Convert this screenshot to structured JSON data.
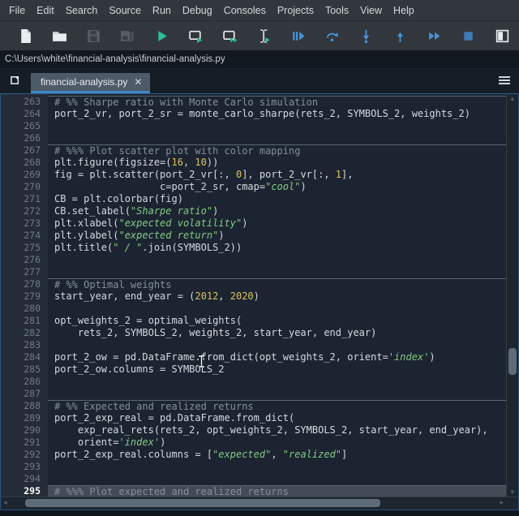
{
  "menu": {
    "items": [
      "File",
      "Edit",
      "Search",
      "Source",
      "Run",
      "Debug",
      "Consoles",
      "Projects",
      "Tools",
      "View",
      "Help"
    ]
  },
  "toolbar": {
    "buttons": [
      {
        "name": "new-file",
        "icon": "new-file-icon",
        "enabled": true
      },
      {
        "name": "open-file",
        "icon": "open-folder-icon",
        "enabled": true
      },
      {
        "name": "save-file",
        "icon": "save-icon",
        "enabled": false
      },
      {
        "name": "save-all",
        "icon": "save-all-icon",
        "enabled": false
      },
      {
        "name": "run-file",
        "icon": "run-icon",
        "enabled": true
      },
      {
        "name": "run-cell",
        "icon": "run-cell-icon",
        "enabled": true
      },
      {
        "name": "run-cell-advance",
        "icon": "run-cell-advance-icon",
        "enabled": true
      },
      {
        "name": "run-selection",
        "icon": "run-selection-icon",
        "enabled": true
      },
      {
        "name": "debug-file",
        "icon": "debug-icon",
        "enabled": true
      },
      {
        "name": "step-over",
        "icon": "step-over-icon",
        "enabled": true
      },
      {
        "name": "step-into",
        "icon": "step-into-icon",
        "enabled": true
      },
      {
        "name": "step-return",
        "icon": "step-return-icon",
        "enabled": true
      },
      {
        "name": "debug-continue",
        "icon": "continue-icon",
        "enabled": true
      },
      {
        "name": "stop-debug",
        "icon": "stop-icon",
        "enabled": true
      },
      {
        "name": "maximize-pane",
        "icon": "maximize-icon",
        "enabled": true
      }
    ]
  },
  "path_bar": {
    "path": "C:\\Users\\white\\financial-analysis\\financial-analysis.py"
  },
  "tab_bar": {
    "tabs": [
      {
        "label": "financial-analysis.py",
        "active": true,
        "close_glyph": "✕"
      }
    ]
  },
  "colors": {
    "accent_blue": "#3f87c6",
    "run_green": "#2ebd96",
    "debug_blue": "#4a90d9",
    "string_green": "#85c885",
    "number_yellow": "#dcc25e",
    "comment_gray": "#858f9a"
  },
  "editor": {
    "first_line": 263,
    "last_line": 295,
    "current_line": 295,
    "lines": [
      {
        "n": 263,
        "cell": true,
        "seg": [
          [
            "c",
            "# %% Sharpe ratio with Monte Carlo simulation"
          ]
        ]
      },
      {
        "n": 264,
        "seg": [
          [
            "",
            "port_2_vr, port_2_sr = monte_carlo_sharpe(rets_2, SYMBOLS_2, weights_2)"
          ]
        ]
      },
      {
        "n": 265,
        "seg": []
      },
      {
        "n": 266,
        "seg": []
      },
      {
        "n": 267,
        "cell": true,
        "seg": [
          [
            "c",
            "# %%% Plot scatter plot with color mapping"
          ]
        ]
      },
      {
        "n": 268,
        "seg": [
          [
            "",
            "plt.figure(figsize=("
          ],
          [
            "n",
            "16"
          ],
          [
            "",
            ", "
          ],
          [
            "n",
            "10"
          ],
          [
            "",
            "))"
          ]
        ]
      },
      {
        "n": 269,
        "seg": [
          [
            "",
            "fig = plt.scatter(port_2_vr[:, "
          ],
          [
            "n",
            "0"
          ],
          [
            "",
            "], port_2_vr[:, "
          ],
          [
            "n",
            "1"
          ],
          [
            "",
            "],"
          ]
        ]
      },
      {
        "n": 270,
        "seg": [
          [
            "",
            "                  c=port_2_sr, cmap="
          ],
          [
            "s",
            "\"cool\""
          ],
          [
            "",
            ")"
          ]
        ]
      },
      {
        "n": 271,
        "seg": [
          [
            "",
            "CB = plt.colorbar(fig)"
          ]
        ]
      },
      {
        "n": 272,
        "seg": [
          [
            "",
            "CB.set_label("
          ],
          [
            "s",
            "\"Sharpe ratio\""
          ],
          [
            "",
            ")"
          ]
        ]
      },
      {
        "n": 273,
        "seg": [
          [
            "",
            "plt.xlabel("
          ],
          [
            "s",
            "\"expected volatility\""
          ],
          [
            "",
            ")"
          ]
        ]
      },
      {
        "n": 274,
        "seg": [
          [
            "",
            "plt.ylabel("
          ],
          [
            "s",
            "\"expected return\""
          ],
          [
            "",
            ")"
          ]
        ]
      },
      {
        "n": 275,
        "seg": [
          [
            "",
            "plt.title("
          ],
          [
            "s",
            "\" / \""
          ],
          [
            "",
            ".join(SYMBOLS_2))"
          ]
        ]
      },
      {
        "n": 276,
        "seg": []
      },
      {
        "n": 277,
        "seg": []
      },
      {
        "n": 278,
        "cell": true,
        "seg": [
          [
            "c",
            "# %% Optimal weights"
          ]
        ]
      },
      {
        "n": 279,
        "seg": [
          [
            "",
            "start_year, end_year = ("
          ],
          [
            "n",
            "2012"
          ],
          [
            "",
            ", "
          ],
          [
            "n",
            "2020"
          ],
          [
            "",
            ")"
          ]
        ]
      },
      {
        "n": 280,
        "seg": []
      },
      {
        "n": 281,
        "seg": [
          [
            "",
            "opt_weights_2 = optimal_weights("
          ]
        ]
      },
      {
        "n": 282,
        "seg": [
          [
            "",
            "    rets_2, SYMBOLS_2, weights_2, start_year, end_year)"
          ]
        ]
      },
      {
        "n": 283,
        "seg": []
      },
      {
        "n": 284,
        "seg": [
          [
            "",
            "port_2_ow = pd.DataFrame.from_dict(opt_weights_2, orient="
          ],
          [
            "s",
            "'index'"
          ],
          [
            "",
            ")"
          ]
        ]
      },
      {
        "n": 285,
        "seg": [
          [
            "",
            "port_2_ow.columns = SYMBOLS_2"
          ]
        ]
      },
      {
        "n": 286,
        "seg": []
      },
      {
        "n": 287,
        "seg": []
      },
      {
        "n": 288,
        "cell": true,
        "seg": [
          [
            "c",
            "# %% Expected and realized returns"
          ]
        ]
      },
      {
        "n": 289,
        "seg": [
          [
            "",
            "port_2_exp_real = pd.DataFrame.from_dict("
          ]
        ]
      },
      {
        "n": 290,
        "seg": [
          [
            "",
            "    exp_real_rets(rets_2, opt_weights_2, SYMBOLS_2, start_year, end_year),"
          ]
        ]
      },
      {
        "n": 291,
        "seg": [
          [
            "",
            "    orient="
          ],
          [
            "s",
            "'index'"
          ],
          [
            "",
            ")"
          ]
        ]
      },
      {
        "n": 292,
        "seg": [
          [
            "",
            "port_2_exp_real.columns = ["
          ],
          [
            "s",
            "\"expected\""
          ],
          [
            "",
            ", "
          ],
          [
            "s",
            "\"realized\""
          ],
          [
            "",
            "]"
          ]
        ]
      },
      {
        "n": 293,
        "seg": []
      },
      {
        "n": 294,
        "seg": []
      },
      {
        "n": 295,
        "cell": true,
        "current": true,
        "seg": [
          [
            "c",
            "# %%% Plot expected and realized returns"
          ]
        ]
      }
    ]
  }
}
